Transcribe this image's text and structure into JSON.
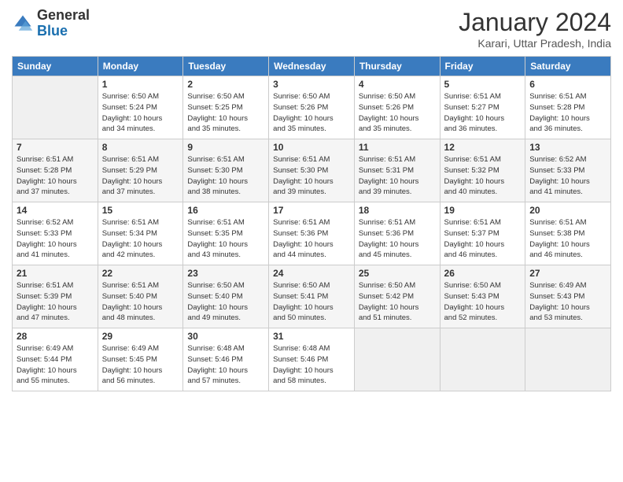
{
  "logo": {
    "general": "General",
    "blue": "Blue"
  },
  "header": {
    "month": "January 2024",
    "location": "Karari, Uttar Pradesh, India"
  },
  "weekdays": [
    "Sunday",
    "Monday",
    "Tuesday",
    "Wednesday",
    "Thursday",
    "Friday",
    "Saturday"
  ],
  "weeks": [
    [
      {
        "day": "",
        "info": ""
      },
      {
        "day": "1",
        "info": "Sunrise: 6:50 AM\nSunset: 5:24 PM\nDaylight: 10 hours\nand 34 minutes."
      },
      {
        "day": "2",
        "info": "Sunrise: 6:50 AM\nSunset: 5:25 PM\nDaylight: 10 hours\nand 35 minutes."
      },
      {
        "day": "3",
        "info": "Sunrise: 6:50 AM\nSunset: 5:26 PM\nDaylight: 10 hours\nand 35 minutes."
      },
      {
        "day": "4",
        "info": "Sunrise: 6:50 AM\nSunset: 5:26 PM\nDaylight: 10 hours\nand 35 minutes."
      },
      {
        "day": "5",
        "info": "Sunrise: 6:51 AM\nSunset: 5:27 PM\nDaylight: 10 hours\nand 36 minutes."
      },
      {
        "day": "6",
        "info": "Sunrise: 6:51 AM\nSunset: 5:28 PM\nDaylight: 10 hours\nand 36 minutes."
      }
    ],
    [
      {
        "day": "7",
        "info": "Sunrise: 6:51 AM\nSunset: 5:28 PM\nDaylight: 10 hours\nand 37 minutes."
      },
      {
        "day": "8",
        "info": "Sunrise: 6:51 AM\nSunset: 5:29 PM\nDaylight: 10 hours\nand 37 minutes."
      },
      {
        "day": "9",
        "info": "Sunrise: 6:51 AM\nSunset: 5:30 PM\nDaylight: 10 hours\nand 38 minutes."
      },
      {
        "day": "10",
        "info": "Sunrise: 6:51 AM\nSunset: 5:30 PM\nDaylight: 10 hours\nand 39 minutes."
      },
      {
        "day": "11",
        "info": "Sunrise: 6:51 AM\nSunset: 5:31 PM\nDaylight: 10 hours\nand 39 minutes."
      },
      {
        "day": "12",
        "info": "Sunrise: 6:51 AM\nSunset: 5:32 PM\nDaylight: 10 hours\nand 40 minutes."
      },
      {
        "day": "13",
        "info": "Sunrise: 6:52 AM\nSunset: 5:33 PM\nDaylight: 10 hours\nand 41 minutes."
      }
    ],
    [
      {
        "day": "14",
        "info": "Sunrise: 6:52 AM\nSunset: 5:33 PM\nDaylight: 10 hours\nand 41 minutes."
      },
      {
        "day": "15",
        "info": "Sunrise: 6:51 AM\nSunset: 5:34 PM\nDaylight: 10 hours\nand 42 minutes."
      },
      {
        "day": "16",
        "info": "Sunrise: 6:51 AM\nSunset: 5:35 PM\nDaylight: 10 hours\nand 43 minutes."
      },
      {
        "day": "17",
        "info": "Sunrise: 6:51 AM\nSunset: 5:36 PM\nDaylight: 10 hours\nand 44 minutes."
      },
      {
        "day": "18",
        "info": "Sunrise: 6:51 AM\nSunset: 5:36 PM\nDaylight: 10 hours\nand 45 minutes."
      },
      {
        "day": "19",
        "info": "Sunrise: 6:51 AM\nSunset: 5:37 PM\nDaylight: 10 hours\nand 46 minutes."
      },
      {
        "day": "20",
        "info": "Sunrise: 6:51 AM\nSunset: 5:38 PM\nDaylight: 10 hours\nand 46 minutes."
      }
    ],
    [
      {
        "day": "21",
        "info": "Sunrise: 6:51 AM\nSunset: 5:39 PM\nDaylight: 10 hours\nand 47 minutes."
      },
      {
        "day": "22",
        "info": "Sunrise: 6:51 AM\nSunset: 5:40 PM\nDaylight: 10 hours\nand 48 minutes."
      },
      {
        "day": "23",
        "info": "Sunrise: 6:50 AM\nSunset: 5:40 PM\nDaylight: 10 hours\nand 49 minutes."
      },
      {
        "day": "24",
        "info": "Sunrise: 6:50 AM\nSunset: 5:41 PM\nDaylight: 10 hours\nand 50 minutes."
      },
      {
        "day": "25",
        "info": "Sunrise: 6:50 AM\nSunset: 5:42 PM\nDaylight: 10 hours\nand 51 minutes."
      },
      {
        "day": "26",
        "info": "Sunrise: 6:50 AM\nSunset: 5:43 PM\nDaylight: 10 hours\nand 52 minutes."
      },
      {
        "day": "27",
        "info": "Sunrise: 6:49 AM\nSunset: 5:43 PM\nDaylight: 10 hours\nand 53 minutes."
      }
    ],
    [
      {
        "day": "28",
        "info": "Sunrise: 6:49 AM\nSunset: 5:44 PM\nDaylight: 10 hours\nand 55 minutes."
      },
      {
        "day": "29",
        "info": "Sunrise: 6:49 AM\nSunset: 5:45 PM\nDaylight: 10 hours\nand 56 minutes."
      },
      {
        "day": "30",
        "info": "Sunrise: 6:48 AM\nSunset: 5:46 PM\nDaylight: 10 hours\nand 57 minutes."
      },
      {
        "day": "31",
        "info": "Sunrise: 6:48 AM\nSunset: 5:46 PM\nDaylight: 10 hours\nand 58 minutes."
      },
      {
        "day": "",
        "info": ""
      },
      {
        "day": "",
        "info": ""
      },
      {
        "day": "",
        "info": ""
      }
    ]
  ]
}
